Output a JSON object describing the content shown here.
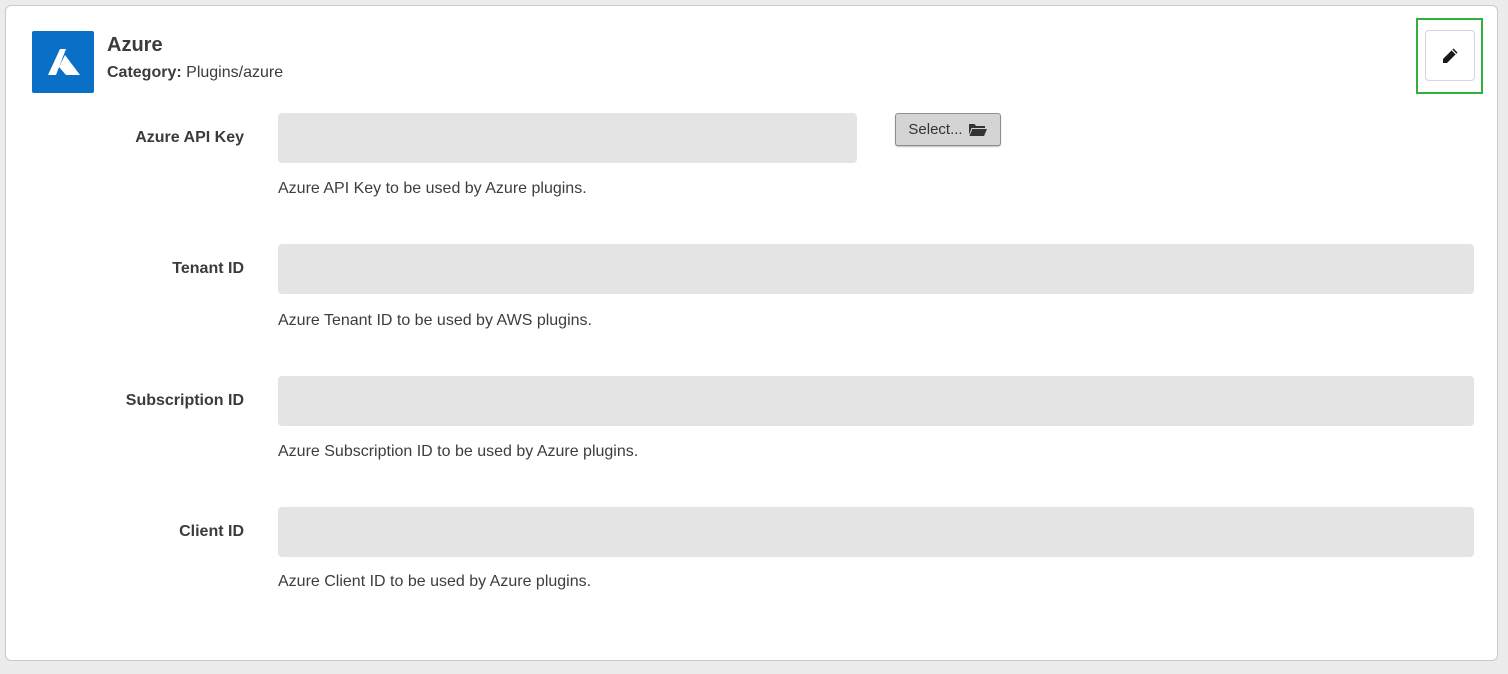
{
  "plugin": {
    "name": "Azure",
    "category_label": "Category:",
    "category_value": "Plugins/azure",
    "logo_icon": "azure-logo-icon",
    "brand_color": "#0a6fc7"
  },
  "toolbar": {
    "edit_icon": "pencil-icon",
    "highlight_color": "#2db23d"
  },
  "fields": {
    "api_key": {
      "label": "Azure API Key",
      "value": "",
      "help": "Azure API Key to be used by Azure plugins.",
      "select_label": "Select...",
      "select_icon": "folder-open-icon"
    },
    "tenant_id": {
      "label": "Tenant ID",
      "value": "",
      "help": "Azure Tenant ID to be used by AWS plugins."
    },
    "subscription_id": {
      "label": "Subscription ID",
      "value": "",
      "help": "Azure Subscription ID to be used by Azure plugins."
    },
    "client_id": {
      "label": "Client ID",
      "value": "",
      "help": "Azure Client ID to be used by Azure plugins."
    }
  }
}
